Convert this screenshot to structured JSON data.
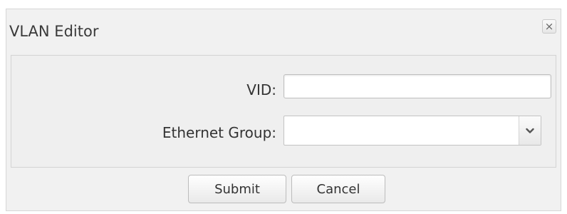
{
  "dialog": {
    "title": "VLAN Editor",
    "close_icon": "close-icon",
    "close_glyph": "×"
  },
  "form": {
    "vid": {
      "label": "VID:",
      "value": ""
    },
    "ethernet_group": {
      "label": "Ethernet Group:",
      "selected": "",
      "arrow_icon": "chevron-down-icon"
    }
  },
  "buttons": {
    "submit_label": "Submit",
    "cancel_label": "Cancel"
  }
}
